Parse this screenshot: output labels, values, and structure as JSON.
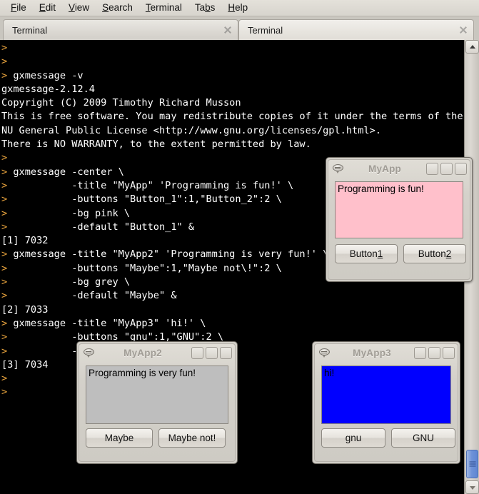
{
  "menubar": {
    "items": [
      {
        "label": "File",
        "mnemonic": "F"
      },
      {
        "label": "Edit",
        "mnemonic": "E"
      },
      {
        "label": "View",
        "mnemonic": "V"
      },
      {
        "label": "Search",
        "mnemonic": "S"
      },
      {
        "label": "Terminal",
        "mnemonic": "T"
      },
      {
        "label": "Tabs",
        "mnemonic": "b"
      },
      {
        "label": "Help",
        "mnemonic": "H"
      }
    ]
  },
  "tabs": [
    {
      "label": "Terminal",
      "close_icon": "close-icon",
      "active": false
    },
    {
      "label": "Terminal",
      "close_icon": "close-icon",
      "active": true
    }
  ],
  "terminal": {
    "prompt": ">",
    "background": "#000000",
    "foreground": "#ffffff",
    "prompt_color": "#e8a33d",
    "lines": [
      ">",
      ">",
      "> gxmessage -v",
      "gxmessage-2.12.4",
      "Copyright (C) 2009 Timothy Richard Musson",
      "This is free software. You may redistribute copies of it under the terms of the G",
      "NU General Public License <http://www.gnu.org/licenses/gpl.html>.",
      "There is NO WARRANTY, to the extent permitted by law.",
      ">",
      "> gxmessage -center \\",
      ">           -title \"MyApp\" 'Programming is fun!' \\",
      ">           -buttons \"Button_1\":1,\"Button_2\":2 \\",
      ">           -bg pink \\",
      ">           -default \"Button_1\" &",
      "[1] 7032",
      "> gxmessage -title \"MyApp2\" 'Programming is very fun!' \\",
      ">           -buttons \"Maybe\":1,\"Maybe not\\!\":2 \\",
      ">           -bg grey \\",
      ">           -default \"Maybe\" &",
      "[2] 7033",
      "> gxmessage -title \"MyApp3\" 'hi!' \\",
      ">           -buttons \"gnu\":1,\"GNU\":2 \\",
      ">           -bg blue \\ &",
      "[3] 7034",
      ">",
      ">"
    ]
  },
  "scrollbar": {
    "up_icon": "scroll-up-arrow-icon",
    "down_icon": "scroll-down-arrow-icon",
    "thumb_color": "#6e92d8"
  },
  "dialogs": [
    {
      "id": "myapp",
      "title": "MyApp",
      "icon": "speech-bubble-icon",
      "message": "Programming is fun!",
      "bg": "#ffc0cb",
      "buttons": [
        {
          "pre": "Button",
          "mn": "1",
          "post": ""
        },
        {
          "pre": "Button",
          "mn": "2",
          "post": ""
        }
      ]
    },
    {
      "id": "myapp2",
      "title": "MyApp2",
      "icon": "speech-bubble-icon",
      "message": "Programming is very fun!",
      "bg": "#bebebe",
      "buttons": [
        {
          "pre": "Maybe",
          "mn": "",
          "post": ""
        },
        {
          "pre": "Maybe not!",
          "mn": "",
          "post": ""
        }
      ]
    },
    {
      "id": "myapp3",
      "title": "MyApp3",
      "icon": "speech-bubble-icon",
      "message": "hi!",
      "bg": "#0000ff",
      "buttons": [
        {
          "pre": "gnu",
          "mn": "",
          "post": ""
        },
        {
          "pre": "GNU",
          "mn": "",
          "post": ""
        }
      ]
    }
  ],
  "window_controls": {
    "minimize": "minimize-button",
    "maximize": "maximize-button",
    "close": "close-button"
  }
}
